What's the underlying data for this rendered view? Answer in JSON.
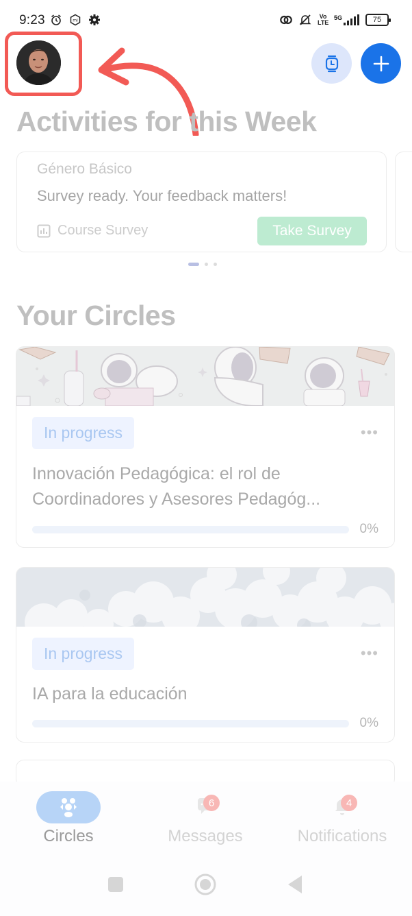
{
  "status_bar": {
    "time": "9:23",
    "left_icons": [
      "alarm-icon",
      "mi-icon",
      "settings-icon"
    ],
    "right_icons": [
      "hotspot-link-icon",
      "bell-muted-icon",
      "volte-icon",
      "signal-5g-icon",
      "battery-icon"
    ],
    "volte_line1": "Vo",
    "volte_line2": "LTE",
    "network": "5G",
    "battery": "75"
  },
  "header": {
    "avatar_alt": "User profile photo",
    "timer_button_icon": "watch-timer-icon",
    "add_button_icon": "plus-icon",
    "annotation_color": "#f25a55"
  },
  "activities": {
    "title": "Activities for this Week",
    "cards": [
      {
        "course": "Género Básico",
        "message": "Survey ready. Your feedback matters!",
        "type_label": "Course Survey",
        "type_icon": "bar-chart-icon",
        "action_label": "Take Survey"
      }
    ],
    "pager": {
      "count": 3,
      "active_index": 0
    }
  },
  "circles": {
    "title": "Your Circles",
    "items": [
      {
        "cover": "astronauts-illustration",
        "status": "In progress",
        "title": "Innovación Pedagógica: el rol de Coordinadores y Asesores Pedagóg...",
        "progress_percent": 0,
        "progress_label": "0%",
        "more_label": "•••"
      },
      {
        "cover": "clouds-photo",
        "status": "In progress",
        "title": "IA para la educación",
        "progress_percent": 0,
        "progress_label": "0%",
        "more_label": "•••"
      }
    ]
  },
  "bottom_nav": {
    "items": [
      {
        "label": "Circles",
        "icon": "circles-icon",
        "active": true,
        "badge": null
      },
      {
        "label": "Messages",
        "icon": "chat-icon",
        "active": false,
        "badge": "6"
      },
      {
        "label": "Notifications",
        "icon": "bell-icon",
        "active": false,
        "badge": "4"
      }
    ]
  },
  "system_nav": [
    "recents-button",
    "home-button",
    "back-button"
  ],
  "colors": {
    "primary": "#1a73e8",
    "badge_bg": "#eef3ff",
    "badge_text": "#a9c7f1",
    "survey_button": "#bdebd1",
    "notification_badge": "#f8b7b5",
    "active_tab_pill": "#b7d4f7"
  }
}
